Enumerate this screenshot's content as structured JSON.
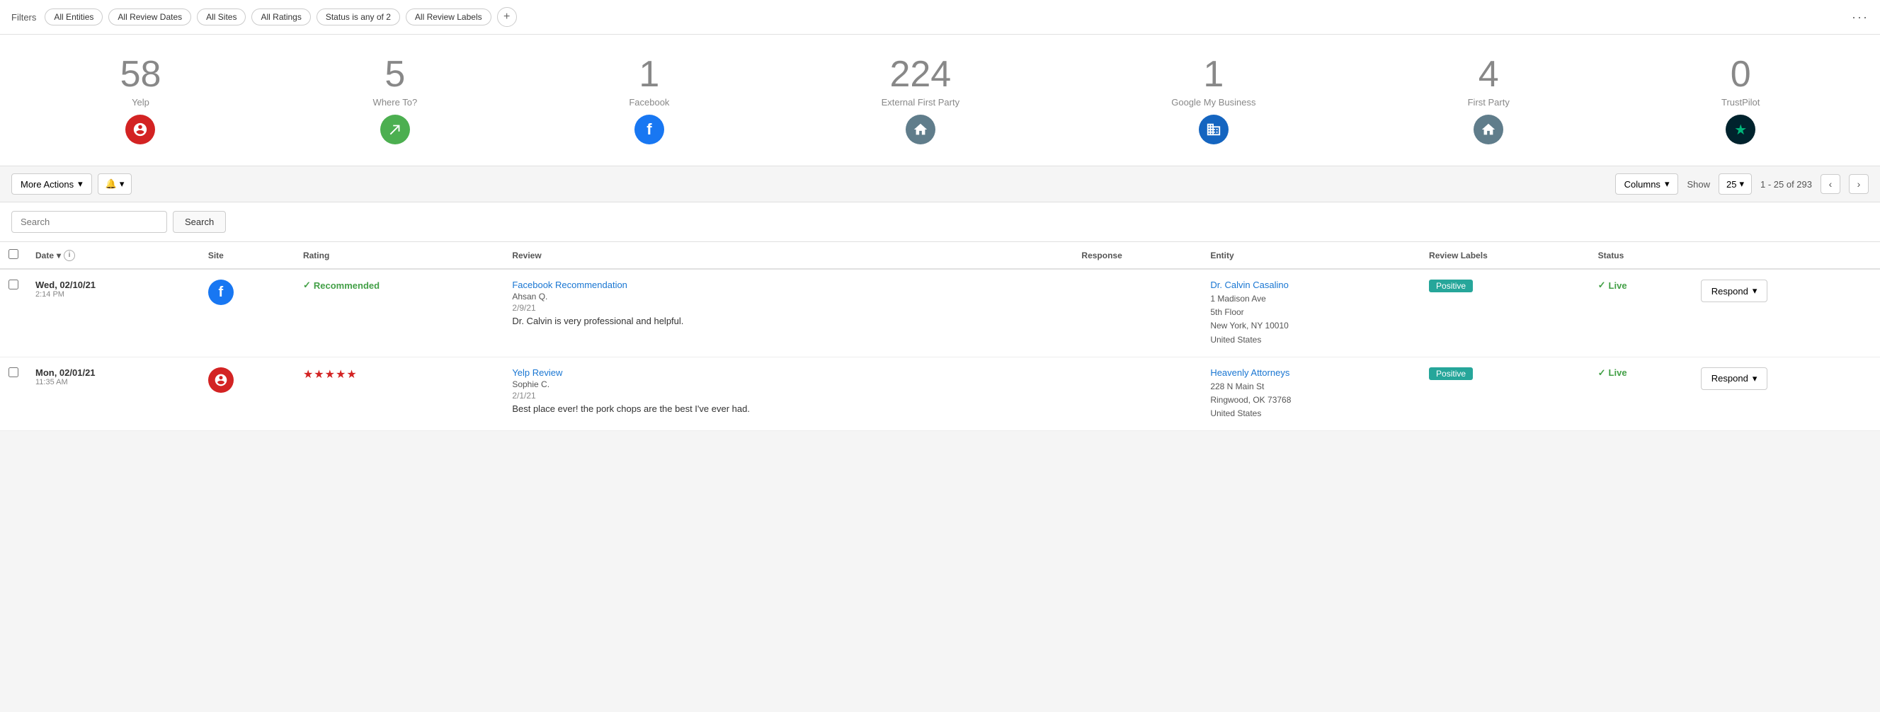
{
  "filters": {
    "label": "Filters",
    "chips": [
      "All Entities",
      "All Review Dates",
      "All Sites",
      "All Ratings",
      "Status is any of 2",
      "All Review Labels"
    ],
    "add_title": "Add filter",
    "more_title": "More options"
  },
  "stats": [
    {
      "id": "yelp",
      "number": "58",
      "label": "Yelp",
      "icon_char": "✿",
      "icon_class": "icon-yelp"
    },
    {
      "id": "whereto",
      "number": "5",
      "label": "Where To?",
      "icon_char": "↗",
      "icon_class": "icon-whereto"
    },
    {
      "id": "facebook",
      "number": "1",
      "label": "Facebook",
      "icon_char": "f",
      "icon_class": "icon-facebook"
    },
    {
      "id": "external",
      "number": "224",
      "label": "External First Party",
      "icon_char": "⌂",
      "icon_class": "icon-external"
    },
    {
      "id": "gmb",
      "number": "1",
      "label": "Google My Business",
      "icon_char": "🏢",
      "icon_class": "icon-gmb"
    },
    {
      "id": "firstparty",
      "number": "4",
      "label": "First Party",
      "icon_char": "⌂",
      "icon_class": "icon-firstparty"
    },
    {
      "id": "trustpilot",
      "number": "0",
      "label": "TrustPilot",
      "icon_char": "★",
      "icon_class": "icon-trustpilot"
    }
  ],
  "toolbar": {
    "more_actions_label": "More Actions",
    "bell_label": "🔔",
    "columns_label": "Columns",
    "show_label": "Show",
    "show_value": "25",
    "pagination": "1 - 25 of 293"
  },
  "search": {
    "placeholder": "Search",
    "button_label": "Search"
  },
  "table": {
    "columns": {
      "date": "Date",
      "site": "Site",
      "rating": "Rating",
      "review": "Review",
      "response": "Response",
      "entity": "Entity",
      "review_labels": "Review Labels",
      "status": "Status"
    },
    "rows": [
      {
        "id": "row1",
        "date": "Wed, 02/10/21",
        "time": "2:14 PM",
        "site_type": "facebook",
        "site_bg": "fb-icon",
        "site_char": "f",
        "rating_type": "recommended",
        "rating_label": "Recommended",
        "review_title": "Facebook Recommendation",
        "review_author": "Ahsan Q.",
        "review_date": "2/9/21",
        "review_text": "Dr. Calvin is very professional and helpful.",
        "response": "",
        "entity_name": "Dr. Calvin Casalino",
        "entity_address": "1 Madison Ave\n5th Floor\nNew York, NY 10010\nUnited States",
        "label": "Positive",
        "label_class": "label-positive",
        "status": "Live"
      },
      {
        "id": "row2",
        "date": "Mon, 02/01/21",
        "time": "11:35 AM",
        "site_type": "yelp",
        "site_bg": "yelp-icon-bg",
        "site_char": "✿",
        "rating_type": "stars",
        "rating_stars": "★★★★★",
        "review_title": "Yelp Review",
        "review_author": "Sophie C.",
        "review_date": "2/1/21",
        "review_text": "Best place ever! the pork chops are the best I've ever had.",
        "response": "",
        "entity_name": "Heavenly Attorneys",
        "entity_address": "228 N Main St\nRingwood, OK 73768\nUnited States",
        "label": "Positive",
        "label_class": "label-positive",
        "status": "Live"
      }
    ]
  }
}
